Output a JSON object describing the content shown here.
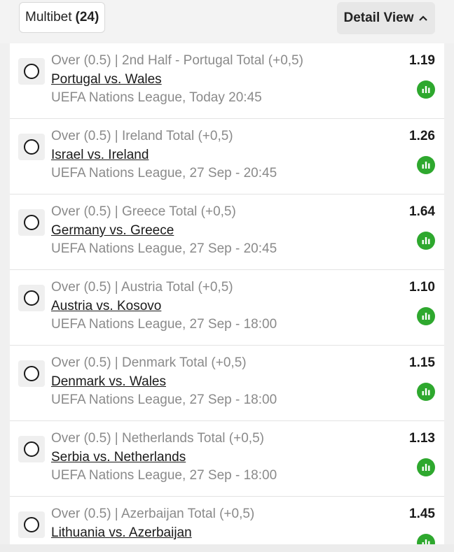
{
  "header": {
    "multibet_label": "Multibet",
    "multibet_count": "(24)",
    "detail_view_label": "Detail View"
  },
  "colors": {
    "accent_green": "#2ea82e",
    "muted_text": "#8a8a8a"
  },
  "bets": [
    {
      "market": "Over (0.5) | 2nd Half - Portugal Total (+0,5)",
      "match": "Portugal vs. Wales",
      "league": "UEFA Nations League, Today 20:45",
      "odds": "1.19"
    },
    {
      "market": "Over (0.5) | Ireland Total (+0,5)",
      "match": "Israel vs. Ireland",
      "league": "UEFA Nations League, 27 Sep - 20:45",
      "odds": "1.26"
    },
    {
      "market": "Over (0.5) | Greece Total (+0,5)",
      "match": "Germany vs. Greece",
      "league": "UEFA Nations League, 27 Sep - 20:45",
      "odds": "1.64"
    },
    {
      "market": "Over (0.5) | Austria Total (+0,5)",
      "match": "Austria vs. Kosovo",
      "league": "UEFA Nations League, 27 Sep - 18:00",
      "odds": "1.10"
    },
    {
      "market": "Over (0.5) | Denmark Total (+0,5)",
      "match": "Denmark vs. Wales",
      "league": "UEFA Nations League, 27 Sep - 18:00",
      "odds": "1.15"
    },
    {
      "market": "Over (0.5) | Netherlands Total (+0,5)",
      "match": "Serbia vs. Netherlands",
      "league": "UEFA Nations League, 27 Sep - 18:00",
      "odds": "1.13"
    },
    {
      "market": "Over (0.5) | Azerbaijan Total (+0,5)",
      "match": "Lithuania vs. Azerbaijan",
      "league": "",
      "odds": "1.45"
    }
  ]
}
